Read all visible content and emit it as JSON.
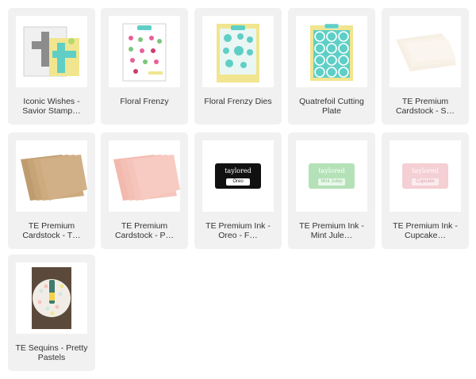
{
  "products": [
    {
      "id": "p1",
      "label": "Iconic Wishes - Savior Stamp…"
    },
    {
      "id": "p2",
      "label": "Floral Frenzy"
    },
    {
      "id": "p3",
      "label": "Floral Frenzy Dies"
    },
    {
      "id": "p4",
      "label": "Quatrefoil Cutting Plate"
    },
    {
      "id": "p5",
      "label": "TE Premium Cardstock - S…"
    },
    {
      "id": "p6",
      "label": "TE Premium Cardstock - T…"
    },
    {
      "id": "p7",
      "label": "TE Premium Cardstock - P…"
    },
    {
      "id": "p8",
      "label": "TE Premium Ink - Oreo - F…"
    },
    {
      "id": "p9",
      "label": "TE Premium Ink - Mint Jule…"
    },
    {
      "id": "p10",
      "label": "TE Premium Ink - Cupcake…"
    },
    {
      "id": "p11",
      "label": "TE Sequins - Pretty Pastels"
    }
  ],
  "thumbs": {
    "brand_text": "taylored",
    "oreo_label": "Oreo",
    "mint_label": "Mint Julep",
    "cupcake_label": "Cupcake"
  },
  "colors": {
    "card_bg": "#f1f1f1",
    "teal": "#5fcfc6",
    "yellow": "#f1e58f",
    "kraft": "#c9a77c",
    "blush": "#f5c4bb",
    "mint": "#b4e1b7",
    "pink_ink": "#f4cfd3"
  }
}
